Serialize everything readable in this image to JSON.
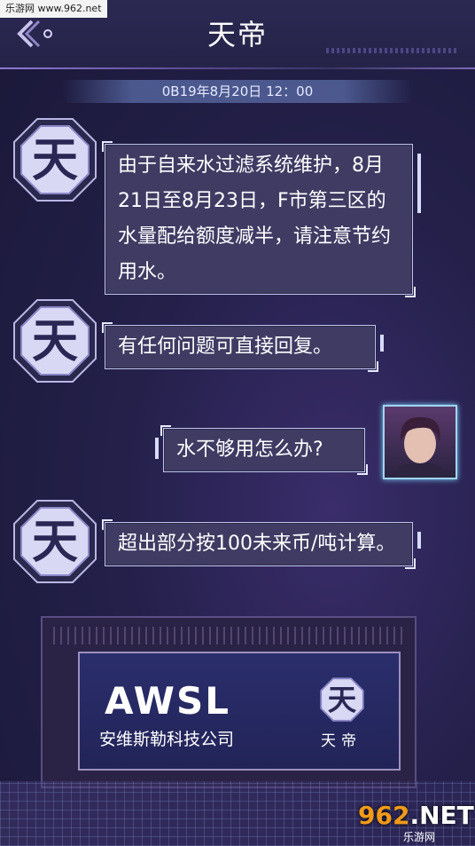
{
  "watermark": {
    "top": "乐游网 www.962.net",
    "logo_main": "962",
    "logo_suffix": ".NET",
    "logo_sub": "乐游网"
  },
  "header": {
    "title": "天帝"
  },
  "timestamp": "0B19年8月20日  12：00",
  "messages": [
    {
      "from": "system",
      "text": "由于自来水过滤系统维护，8月21日至8月23日，F市第三区的水量配给额度减半，请注意节约用水。"
    },
    {
      "from": "system",
      "text": "有任何问题可直接回复。"
    },
    {
      "from": "user",
      "text": "水不够用怎么办?"
    },
    {
      "from": "system",
      "text": "超出部分按100未来币/吨计算。"
    }
  ],
  "avatar_glyph": "天",
  "card": {
    "logo_text": "AWSL",
    "company": "安维斯勒科技公司",
    "badge_glyph": "天",
    "badge_label": "天帝"
  },
  "colors": {
    "accent": "#6c5aa3",
    "bubble": "#3f3b63",
    "bubble_border": "#bfc4ee"
  }
}
